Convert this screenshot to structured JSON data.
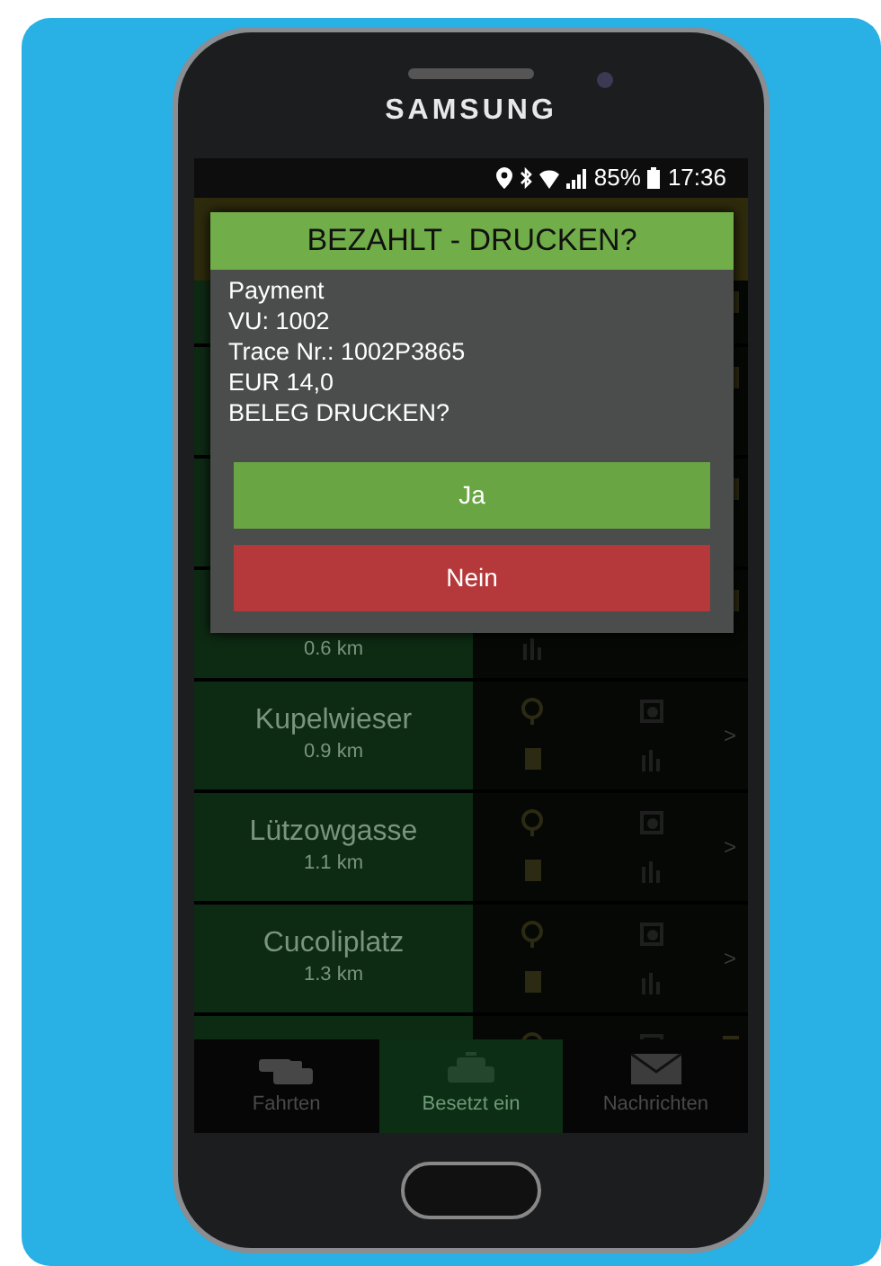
{
  "device": {
    "brand": "SAMSUNG"
  },
  "status_bar": {
    "battery": "85%",
    "time": "17:36"
  },
  "list": {
    "rows": [
      {
        "kind": "hidden"
      },
      {
        "kind": "hidden"
      },
      {
        "kind": "hidden"
      },
      {
        "kind": "distance_only",
        "distance": "0.6 km"
      },
      {
        "kind": "stop",
        "name": "Kupelwieser",
        "distance": "0.9 km",
        "chevron": ">"
      },
      {
        "kind": "stop",
        "name": "Lützowgasse",
        "distance": "1.1 km",
        "chevron": ">"
      },
      {
        "kind": "stop",
        "name": "Cucoliplatz",
        "distance": "1.3 km",
        "chevron": ">"
      },
      {
        "kind": "hidden"
      }
    ]
  },
  "dialog": {
    "title": "BEZAHLT - DRUCKEN?",
    "lines": [
      "Payment",
      "VU: 1002",
      "Trace Nr.: 1002P3865",
      "EUR 14,0",
      "BELEG DRUCKEN?"
    ],
    "buttons": [
      {
        "label": "Ja",
        "kind": "confirm"
      },
      {
        "label": "Nein",
        "kind": "cancel"
      }
    ]
  },
  "bottom_nav": [
    {
      "label": "Fahrten",
      "selected": false
    },
    {
      "label": "Besetzt ein",
      "selected": true
    },
    {
      "label": "Nachrichten",
      "selected": false
    }
  ]
}
